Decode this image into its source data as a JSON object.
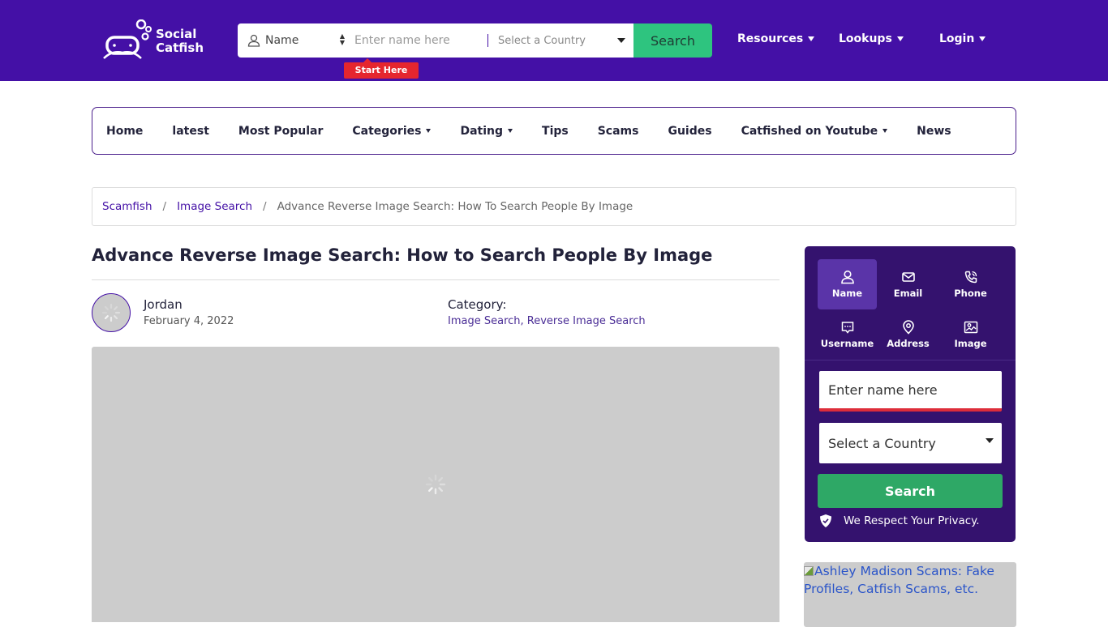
{
  "header": {
    "logo_line1": "Social",
    "logo_line2": "Catfish",
    "search": {
      "type_label": "Name",
      "input_placeholder": "Enter name here",
      "country_value": "Select a Country",
      "button_label": "Search",
      "start_here": "Start Here"
    },
    "nav": [
      {
        "label": "Resources"
      },
      {
        "label": "Lookups"
      },
      {
        "label": "Login"
      }
    ]
  },
  "mainnav": [
    {
      "label": "Home",
      "dropdown": false
    },
    {
      "label": "latest",
      "dropdown": false
    },
    {
      "label": "Most Popular",
      "dropdown": false
    },
    {
      "label": "Categories",
      "dropdown": true
    },
    {
      "label": "Dating",
      "dropdown": true
    },
    {
      "label": "Tips",
      "dropdown": false
    },
    {
      "label": "Scams",
      "dropdown": false
    },
    {
      "label": "Guides",
      "dropdown": false
    },
    {
      "label": "Catfished on Youtube",
      "dropdown": true
    },
    {
      "label": "News",
      "dropdown": false
    }
  ],
  "breadcrumb": {
    "items": [
      "Scamfish",
      "Image Search"
    ],
    "separator": "/",
    "current": "Advance Reverse Image Search: How To Search People By Image"
  },
  "article": {
    "title": "Advance Reverse Image Search: How to Search People By Image",
    "author": "Jordan",
    "date": "February 4, 2022",
    "category_label": "Category:",
    "categories": "Image Search, Reverse Image Search"
  },
  "widget": {
    "tabs": [
      {
        "label": "Name",
        "icon": "user-icon",
        "active": true
      },
      {
        "label": "Email",
        "icon": "envelope-icon",
        "active": false
      },
      {
        "label": "Phone",
        "icon": "phone-icon",
        "active": false
      },
      {
        "label": "Username",
        "icon": "chat-icon",
        "active": false
      },
      {
        "label": "Address",
        "icon": "location-pin-icon",
        "active": false
      },
      {
        "label": "Image",
        "icon": "image-icon",
        "active": false
      }
    ],
    "input_placeholder": "Enter name here",
    "country_value": "Select a Country",
    "button_label": "Search",
    "privacy_text": "We Respect Your Privacy."
  },
  "ad": {
    "alt_text": "Ashley Madison Scams: Fake Profiles, Catfish Scams, etc."
  },
  "colors": {
    "brand_purple": "#4410a6",
    "widget_purple": "#34126e",
    "search_green": "#2ec47f",
    "widget_green": "#2ea866",
    "start_here_red": "#e5262e"
  }
}
